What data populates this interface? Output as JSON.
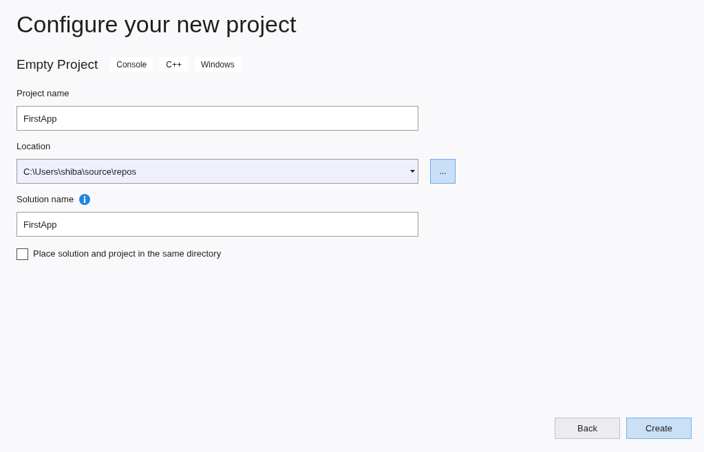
{
  "title": "Configure your new project",
  "template": {
    "name": "Empty Project",
    "tags": [
      "Console",
      "C++",
      "Windows"
    ]
  },
  "fields": [
    {
      "kind": "text",
      "label": "Project name",
      "info": false,
      "focused": false,
      "value": "FirstApp"
    },
    {
      "kind": "combo",
      "label": "Location",
      "info": false,
      "focused": true,
      "value": "C:\\Users\\shiba\\source\\repos",
      "browse_button": "..."
    },
    {
      "kind": "text",
      "label": "Solution name",
      "info": true,
      "focused": false,
      "value": "FirstApp"
    }
  ],
  "same_directory": {
    "label": "Place solution and project in the same directory",
    "checked": false
  },
  "buttons": [
    {
      "label": "Back",
      "kind": "default"
    },
    {
      "label": "Create",
      "kind": "primary"
    }
  ]
}
